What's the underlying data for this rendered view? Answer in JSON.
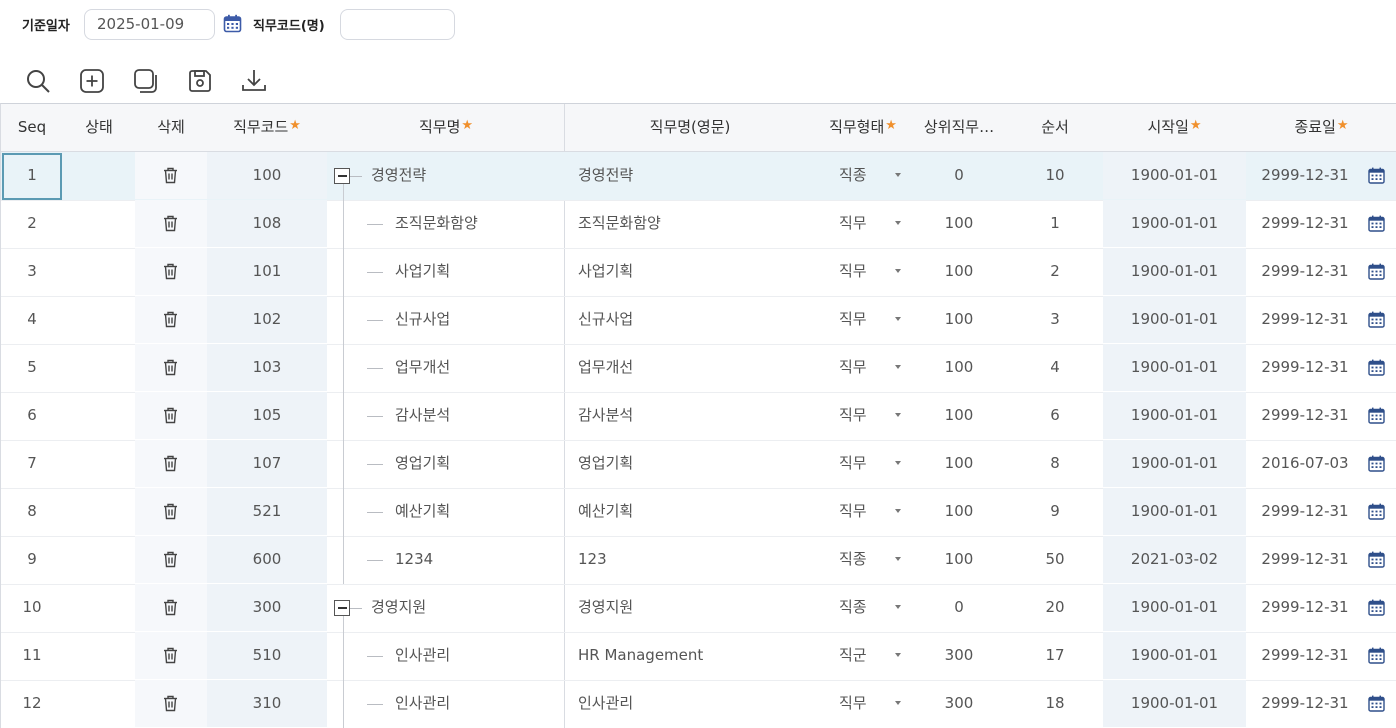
{
  "filter": {
    "date_label": "기준일자",
    "date_value": "2025-01-09",
    "code_label": "직무코드(명)",
    "code_value": ""
  },
  "toolbar": {
    "icons": [
      "search-icon",
      "add-icon",
      "copy-icon",
      "save-icon",
      "download-icon"
    ]
  },
  "colors": {
    "required_star": "#f0902d",
    "selected_row": "#e9f3f8",
    "selected_border": "#5b9ab3",
    "band": "#eef3f8"
  },
  "grid": {
    "headers": {
      "seq": "Seq",
      "status": "상태",
      "delete": "삭제",
      "code": "직무코드",
      "name": "직무명",
      "name_en": "직무명(영문)",
      "type": "직무형태",
      "parent": "상위직무…",
      "order": "순서",
      "start": "시작일",
      "end": "종료일"
    },
    "star": "★",
    "rows": [
      {
        "seq": "1",
        "code": "100",
        "name": "경영전략",
        "name_en": "경영전략",
        "type": "직종",
        "parent": "0",
        "order": "10",
        "start": "1900-01-01",
        "end": "2999-12-31",
        "level": 0
      },
      {
        "seq": "2",
        "code": "108",
        "name": "조직문화함양",
        "name_en": "조직문화함양",
        "type": "직무",
        "parent": "100",
        "order": "1",
        "start": "1900-01-01",
        "end": "2999-12-31",
        "level": 1
      },
      {
        "seq": "3",
        "code": "101",
        "name": "사업기획",
        "name_en": "사업기획",
        "type": "직무",
        "parent": "100",
        "order": "2",
        "start": "1900-01-01",
        "end": "2999-12-31",
        "level": 1
      },
      {
        "seq": "4",
        "code": "102",
        "name": "신규사업",
        "name_en": "신규사업",
        "type": "직무",
        "parent": "100",
        "order": "3",
        "start": "1900-01-01",
        "end": "2999-12-31",
        "level": 1
      },
      {
        "seq": "5",
        "code": "103",
        "name": "업무개선",
        "name_en": "업무개선",
        "type": "직무",
        "parent": "100",
        "order": "4",
        "start": "1900-01-01",
        "end": "2999-12-31",
        "level": 1
      },
      {
        "seq": "6",
        "code": "105",
        "name": "감사분석",
        "name_en": "감사분석",
        "type": "직무",
        "parent": "100",
        "order": "6",
        "start": "1900-01-01",
        "end": "2999-12-31",
        "level": 1
      },
      {
        "seq": "7",
        "code": "107",
        "name": "영업기획",
        "name_en": "영업기획",
        "type": "직무",
        "parent": "100",
        "order": "8",
        "start": "1900-01-01",
        "end": "2016-07-03",
        "level": 1
      },
      {
        "seq": "8",
        "code": "521",
        "name": "예산기획",
        "name_en": "예산기획",
        "type": "직무",
        "parent": "100",
        "order": "9",
        "start": "1900-01-01",
        "end": "2999-12-31",
        "level": 1
      },
      {
        "seq": "9",
        "code": "600",
        "name": "1234",
        "name_en": "123",
        "type": "직종",
        "parent": "100",
        "order": "50",
        "start": "2021-03-02",
        "end": "2999-12-31",
        "level": 1
      },
      {
        "seq": "10",
        "code": "300",
        "name": "경영지원",
        "name_en": "경영지원",
        "type": "직종",
        "parent": "0",
        "order": "20",
        "start": "1900-01-01",
        "end": "2999-12-31",
        "level": 0
      },
      {
        "seq": "11",
        "code": "510",
        "name": "인사관리",
        "name_en": "HR Management",
        "type": "직군",
        "parent": "300",
        "order": "17",
        "start": "1900-01-01",
        "end": "2999-12-31",
        "level": 1
      },
      {
        "seq": "12",
        "code": "310",
        "name": "인사관리",
        "name_en": "인사관리",
        "type": "직무",
        "parent": "300",
        "order": "18",
        "start": "1900-01-01",
        "end": "2999-12-31",
        "level": 1
      }
    ]
  }
}
